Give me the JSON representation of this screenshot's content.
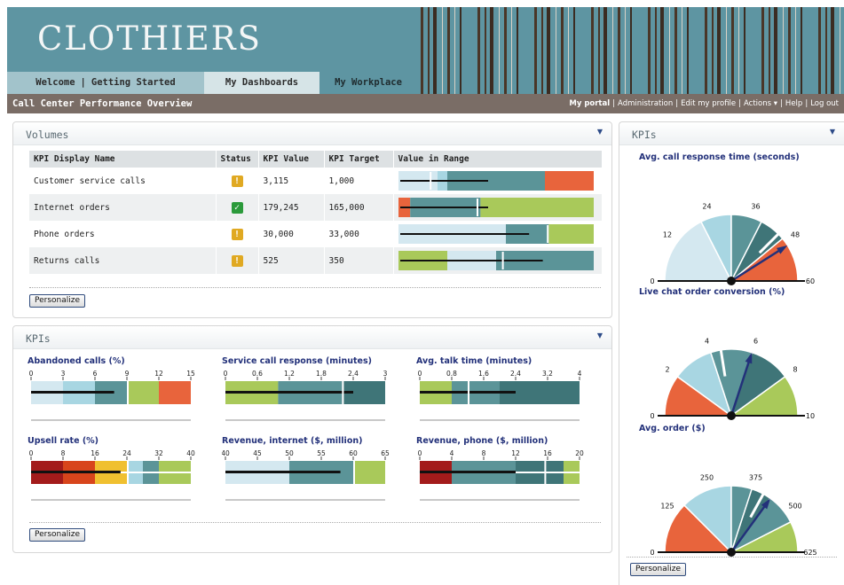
{
  "app": {
    "logo": "CLOTHIERS",
    "nav": {
      "welcome": "Welcome",
      "getting_started": "Getting Started",
      "dashboards": "My Dashboards",
      "workplace": "My Workplace"
    },
    "page_title": "Call Center Performance Overview",
    "user_links": {
      "portal": "My portal",
      "admin": "Administration",
      "profile": "Edit my profile",
      "actions": "Actions ▾",
      "help": "Help",
      "logout": "Log out"
    }
  },
  "volumes": {
    "title": "Volumes",
    "columns": [
      "KPI Display Name",
      "Status",
      "KPI Value",
      "KPI Target",
      "Value in Range"
    ],
    "rows": [
      {
        "name": "Customer service calls",
        "status": "warning",
        "status_glyph": "!",
        "value": "3,115",
        "target": "1,000",
        "bands": [
          {
            "w": 0.2,
            "c": "#d4e8f0"
          },
          {
            "w": 0.05,
            "c": "#a8d6e2"
          },
          {
            "w": 0.5,
            "c": "#5b9498"
          },
          {
            "w": 0.25,
            "c": "#e8643c"
          }
        ],
        "measure": 0.45,
        "tick": 0.16
      },
      {
        "name": "Internet orders",
        "status": "ok",
        "status_glyph": "✓",
        "value": "179,245",
        "target": "165,000",
        "bands": [
          {
            "w": 0.06,
            "c": "#e8643c"
          },
          {
            "w": 0.36,
            "c": "#5b9498"
          },
          {
            "w": 0.58,
            "c": "#a9c95a"
          }
        ],
        "measure": 0.45,
        "tick": 0.4
      },
      {
        "name": "Phone orders",
        "status": "warning",
        "status_glyph": "!",
        "value": "30,000",
        "target": "33,000",
        "bands": [
          {
            "w": 0.55,
            "c": "#d4e8f0"
          },
          {
            "w": 0.22,
            "c": "#5b9498"
          },
          {
            "w": 0.23,
            "c": "#a9c95a"
          }
        ],
        "measure": 0.66,
        "tick": 0.76
      },
      {
        "name": "Returns calls",
        "status": "warning",
        "status_glyph": "!",
        "value": "525",
        "target": "350",
        "bands": [
          {
            "w": 0.25,
            "c": "#a9c95a"
          },
          {
            "w": 0.25,
            "c": "#d4e8f0"
          },
          {
            "w": 0.5,
            "c": "#5b9498"
          }
        ],
        "measure": 0.73,
        "tick": 0.53
      }
    ],
    "personalize": "Personalize"
  },
  "kpis": {
    "title": "KPIs",
    "personalize": "Personalize",
    "bullets": [
      {
        "title": "Abandoned calls (%)",
        "ticks": [
          "0",
          "3",
          "6",
          "9",
          "12",
          "15"
        ],
        "bands": [
          {
            "w": 0.2,
            "c": "#d4e8f0"
          },
          {
            "w": 0.2,
            "c": "#a8d6e2"
          },
          {
            "w": 0.2,
            "c": "#5b9498"
          },
          {
            "w": 0.2,
            "c": "#a9c95a"
          },
          {
            "w": 0.2,
            "c": "#e8643c"
          }
        ],
        "measure": 0.52,
        "tick": 0.6
      },
      {
        "title": "Service call response (minutes)",
        "ticks": [
          "0",
          "0.6",
          "1.2",
          "1.8",
          "2.4",
          "3"
        ],
        "bands": [
          {
            "w": 0.33,
            "c": "#a9c95a"
          },
          {
            "w": 0.4,
            "c": "#5b9498"
          },
          {
            "w": 0.27,
            "c": "#3f7578"
          }
        ],
        "measure": 0.8,
        "tick": 0.73
      },
      {
        "title": "Avg. talk time (minutes)",
        "ticks": [
          "0",
          "0.8",
          "1.6",
          "2.4",
          "3.2",
          "4"
        ],
        "bands": [
          {
            "w": 0.2,
            "c": "#a9c95a"
          },
          {
            "w": 0.3,
            "c": "#5b9498"
          },
          {
            "w": 0.5,
            "c": "#3f7578"
          }
        ],
        "measure": 0.6,
        "tick": 0.3
      },
      {
        "title": "Upsell rate (%)",
        "ticks": [
          "0",
          "8",
          "16",
          "24",
          "32",
          "40"
        ],
        "bands": [
          {
            "w": 0.2,
            "c": "#a31b1b"
          },
          {
            "w": 0.2,
            "c": "#d8451c"
          },
          {
            "w": 0.2,
            "c": "#f0c030"
          },
          {
            "w": 0.1,
            "c": "#a8d6e2"
          },
          {
            "w": 0.1,
            "c": "#5b9498"
          },
          {
            "w": 0.2,
            "c": "#a9c95a"
          }
        ],
        "measure": 0.56,
        "tick": 0.6,
        "split": true
      },
      {
        "title": "Revenue, internet ($, million)",
        "ticks": [
          "40",
          "45",
          "50",
          "55",
          "60",
          "65"
        ],
        "bands": [
          {
            "w": 0.4,
            "c": "#d4e8f0"
          },
          {
            "w": 0.4,
            "c": "#5b9498"
          },
          {
            "w": 0.2,
            "c": "#a9c95a"
          }
        ],
        "measure": 0.72,
        "tick": 0.8
      },
      {
        "title": "Revenue, phone ($, million)",
        "ticks": [
          "0",
          "4",
          "8",
          "12",
          "16",
          "20"
        ],
        "bands": [
          {
            "w": 0.2,
            "c": "#a31b1b"
          },
          {
            "w": 0.4,
            "c": "#5b9498"
          },
          {
            "w": 0.3,
            "c": "#3f7578"
          },
          {
            "w": 0.1,
            "c": "#a9c95a"
          }
        ],
        "measure": 0.6,
        "tick": 0.78,
        "split": true
      }
    ]
  },
  "right_kpis": {
    "title": "KPIs",
    "personalize": "Personalize",
    "gauges": [
      {
        "title": "Avg. call response time (seconds)",
        "ticks": [
          "0",
          "12",
          "24",
          "36",
          "48",
          "60"
        ],
        "bands": [
          {
            "to": 0.35,
            "c": "#d4e8f0"
          },
          {
            "to": 0.5,
            "c": "#a8d6e2"
          },
          {
            "to": 0.65,
            "c": "#5b9498"
          },
          {
            "to": 0.78,
            "c": "#3f7578"
          },
          {
            "to": 1,
            "c": "#e8643c"
          }
        ],
        "needle": 0.82,
        "marker": 0.75
      },
      {
        "title": "Live chat order conversion (%)",
        "ticks": [
          "0",
          "2",
          "4",
          "6",
          "8",
          "10"
        ],
        "bands": [
          {
            "to": 0.2,
            "c": "#e8643c"
          },
          {
            "to": 0.4,
            "c": "#a8d6e2"
          },
          {
            "to": 0.6,
            "c": "#5b9498"
          },
          {
            "to": 0.8,
            "c": "#3f7578"
          },
          {
            "to": 1,
            "c": "#a9c95a"
          }
        ],
        "needle": 0.6,
        "marker": 0.45
      },
      {
        "title": "Avg. order ($)",
        "ticks": [
          "0",
          "125",
          "250",
          "375",
          "500",
          "625"
        ],
        "bands": [
          {
            "to": 0.25,
            "c": "#e8643c"
          },
          {
            "to": 0.5,
            "c": "#a8d6e2"
          },
          {
            "to": 0.6,
            "c": "#5b9498"
          },
          {
            "to": 0.7,
            "c": "#3f7578"
          },
          {
            "to": 0.85,
            "c": "#5b9498"
          },
          {
            "to": 1,
            "c": "#a9c95a"
          }
        ],
        "needle": 0.7,
        "marker": 0.66
      }
    ]
  },
  "colors": {
    "header": "#5e95a2",
    "titlebar": "#7a6d66",
    "kpi_title": "#23317a",
    "needle": "#23317a"
  }
}
